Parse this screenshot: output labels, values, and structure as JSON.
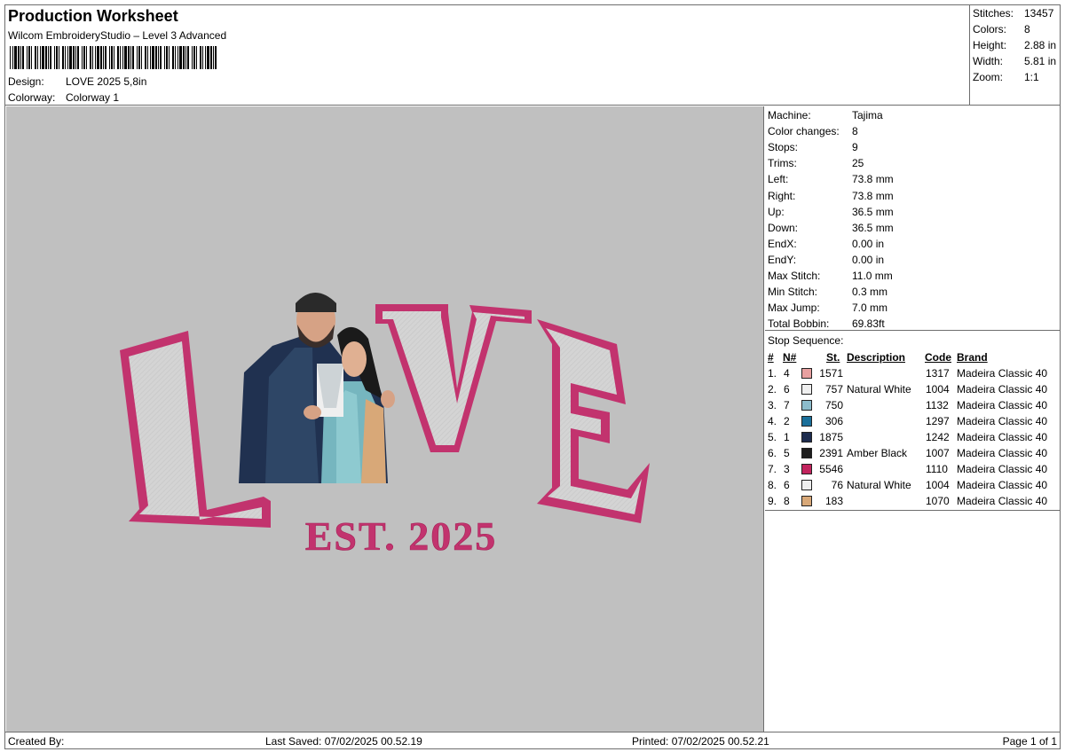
{
  "header": {
    "title": "Production Worksheet",
    "subtitle": "Wilcom EmbroideryStudio – Level 3 Advanced",
    "design_label": "Design:",
    "design_value": "LOVE 2025 5,8in",
    "colorway_label": "Colorway:",
    "colorway_value": "Colorway 1"
  },
  "summary": {
    "stitches_label": "Stitches:",
    "stitches": "13457",
    "colors_label": "Colors:",
    "colors": "8",
    "height_label": "Height:",
    "height": "2.88 in",
    "width_label": "Width:",
    "width": "5.81 in",
    "zoom_label": "Zoom:",
    "zoom": "1:1"
  },
  "machine": {
    "rows": [
      {
        "label": "Machine:",
        "value": "Tajima"
      },
      {
        "label": "Color changes:",
        "value": "8"
      },
      {
        "label": "Stops:",
        "value": "9"
      },
      {
        "label": "Trims:",
        "value": "25"
      },
      {
        "label": "Left:",
        "value": "73.8 mm"
      },
      {
        "label": "Right:",
        "value": "73.8 mm"
      },
      {
        "label": "Up:",
        "value": "36.5 mm"
      },
      {
        "label": "Down:",
        "value": "36.5 mm"
      },
      {
        "label": "EndX:",
        "value": "0.00 in"
      },
      {
        "label": "EndY:",
        "value": "0.00 in"
      },
      {
        "label": "Max Stitch:",
        "value": "11.0 mm"
      },
      {
        "label": "Min Stitch:",
        "value": "0.3 mm"
      },
      {
        "label": "Max Jump:",
        "value": "7.0 mm"
      },
      {
        "label": "Total Bobbin:",
        "value": "69.83ft"
      }
    ]
  },
  "stop_sequence": {
    "title": "Stop Sequence:",
    "headers": {
      "num": "#",
      "needle": "N#",
      "st": "St.",
      "desc": "Description",
      "code": "Code",
      "brand": "Brand"
    },
    "rows": [
      {
        "num": "1.",
        "needle": "4",
        "color": "#e8a0a0",
        "st": "1571",
        "desc": "",
        "code": "1317",
        "brand": "Madeira Classic 40"
      },
      {
        "num": "2.",
        "needle": "6",
        "color": "#efefef",
        "st": "757",
        "desc": "Natural White",
        "code": "1004",
        "brand": "Madeira Classic 40"
      },
      {
        "num": "3.",
        "needle": "7",
        "color": "#8cbccc",
        "st": "750",
        "desc": "",
        "code": "1132",
        "brand": "Madeira Classic 40"
      },
      {
        "num": "4.",
        "needle": "2",
        "color": "#1a6f9a",
        "st": "306",
        "desc": "",
        "code": "1297",
        "brand": "Madeira Classic 40"
      },
      {
        "num": "5.",
        "needle": "1",
        "color": "#1d2c4e",
        "st": "1875",
        "desc": "",
        "code": "1242",
        "brand": "Madeira Classic 40"
      },
      {
        "num": "6.",
        "needle": "5",
        "color": "#1e1e1e",
        "st": "2391",
        "desc": "Amber Black",
        "code": "1007",
        "brand": "Madeira Classic 40"
      },
      {
        "num": "7.",
        "needle": "3",
        "color": "#c2245e",
        "st": "5546",
        "desc": "",
        "code": "1110",
        "brand": "Madeira Classic 40"
      },
      {
        "num": "8.",
        "needle": "6",
        "color": "#efefef",
        "st": "76",
        "desc": "Natural White",
        "code": "1004",
        "brand": "Madeira Classic 40"
      },
      {
        "num": "9.",
        "needle": "8",
        "color": "#d8a878",
        "st": "183",
        "desc": "",
        "code": "1070",
        "brand": "Madeira Classic 40"
      }
    ]
  },
  "design_preview": {
    "letters": [
      "L",
      "V",
      "E"
    ],
    "est_text": "EST. 2025",
    "thread_color": "#c2336e",
    "background": "#c0c0c0"
  },
  "footer": {
    "created_by": "Created By:",
    "last_saved": "Last Saved: 07/02/2025 00.52.19",
    "printed": "Printed: 07/02/2025 00.52.21",
    "page": "Page 1 of 1"
  }
}
